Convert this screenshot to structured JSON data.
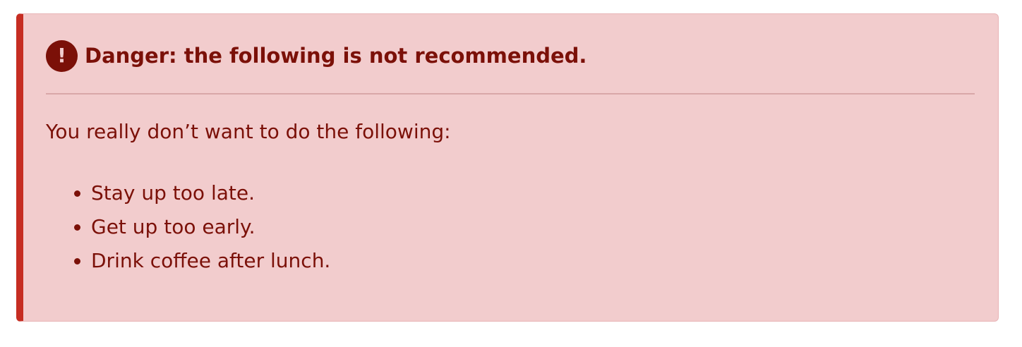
{
  "callout": {
    "type": "danger",
    "icon": "exclamation-circle-icon",
    "icon_glyph": "!",
    "title": "Danger: the following is not recommended.",
    "intro": "You really don’t want to do the following:",
    "items": [
      "Stay up too late.",
      "Get up too early.",
      "Drink coffee after lunch."
    ]
  },
  "colors": {
    "background": "#f2cccd",
    "accent_border": "#c62d22",
    "text": "#7b1008"
  }
}
